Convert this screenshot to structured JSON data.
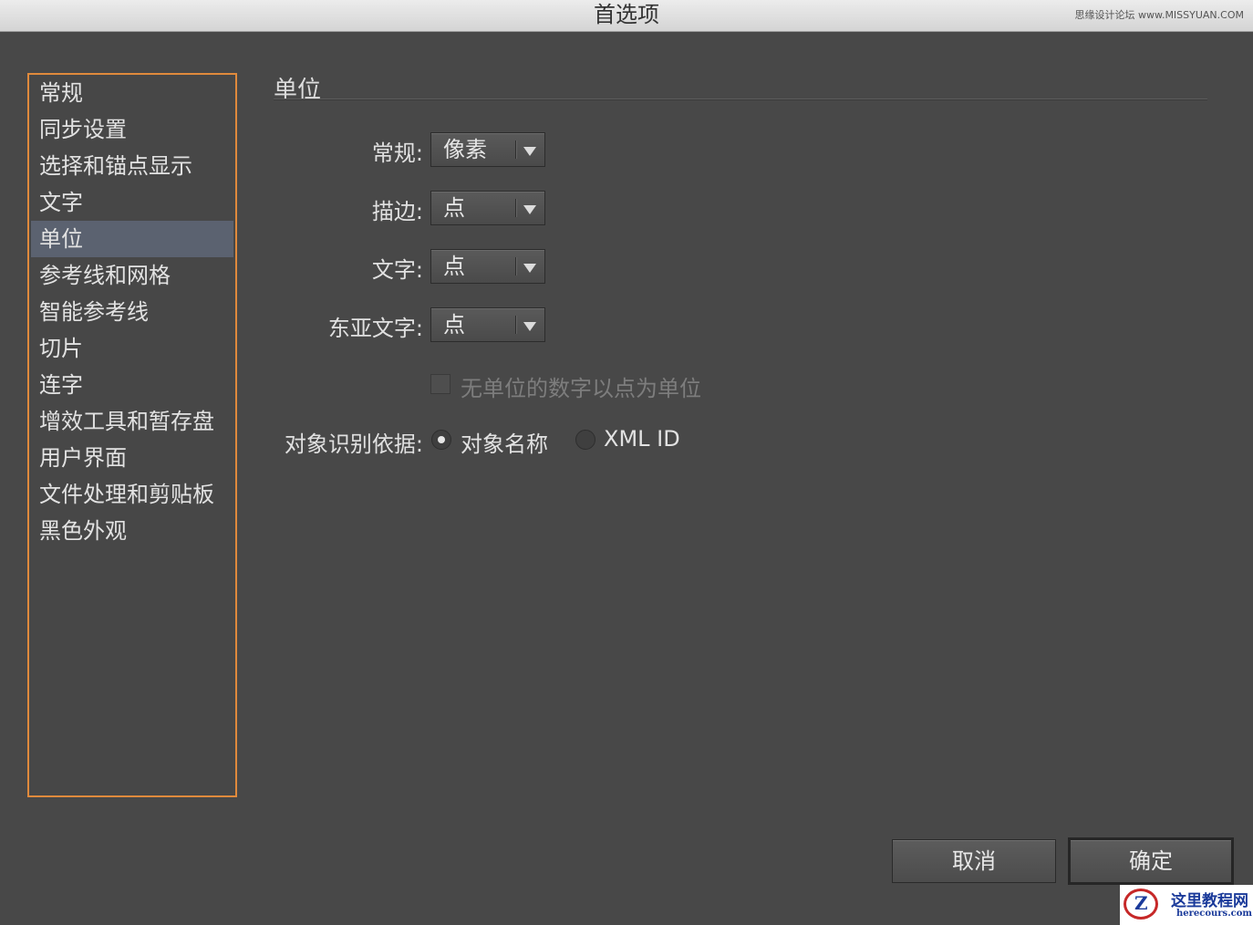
{
  "window": {
    "title": "首选项",
    "watermark": "思缘设计论坛 www.MISSYUAN.COM"
  },
  "sidebar": {
    "items": [
      {
        "label": "常规"
      },
      {
        "label": "同步设置"
      },
      {
        "label": "选择和锚点显示"
      },
      {
        "label": "文字"
      },
      {
        "label": "单位",
        "selected": true
      },
      {
        "label": "参考线和网格"
      },
      {
        "label": "智能参考线"
      },
      {
        "label": "切片"
      },
      {
        "label": "连字"
      },
      {
        "label": "增效工具和暂存盘"
      },
      {
        "label": "用户界面"
      },
      {
        "label": "文件处理和剪贴板"
      },
      {
        "label": "黑色外观"
      }
    ]
  },
  "panel": {
    "title": "单位",
    "general": {
      "label": "常规:",
      "value": "像素"
    },
    "stroke": {
      "label": "描边:",
      "value": "点"
    },
    "type": {
      "label": "文字:",
      "value": "点"
    },
    "asian_type": {
      "label": "东亚文字:",
      "value": "点"
    },
    "numbers_checkbox": {
      "label": "无单位的数字以点为单位",
      "checked": false,
      "disabled": true
    },
    "identify": {
      "label": "对象识别依据:",
      "option_name": "对象名称",
      "option_xml": "XML ID",
      "selected": "对象名称"
    }
  },
  "buttons": {
    "cancel": "取消",
    "ok": "确定"
  },
  "logo": {
    "cn": "这里教程网",
    "en": "herecours.com",
    "mark": "Z"
  }
}
